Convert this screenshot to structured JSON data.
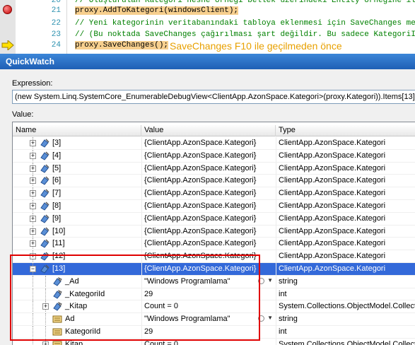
{
  "editor": {
    "lines": [
      {
        "num": "20",
        "text": "// Oluşturulan Kategori nesne örneği bellek üzerindeki Entity örneğine ilave edilir",
        "kind": "comment"
      },
      {
        "num": "21",
        "text": "proxy.AddToKategori(windowsClient);",
        "kind": "highlight"
      },
      {
        "num": "22",
        "text": "// Yeni kategorinin veritabanındaki tabloya eklenmesi için SaveChanges metodu çağırılır.",
        "kind": "comment"
      },
      {
        "num": "23",
        "text": "// (Bu noktada SaveChanges çağırılması şart değildir. Bu sadece KategoriId' nin tablodan e",
        "kind": "comment"
      },
      {
        "num": "24",
        "text": "proxy.SaveChanges();",
        "kind": "highlight"
      }
    ],
    "annotation": "SaveChanges F10 ile geçilmeden önce",
    "annotation_color": "#e8a000"
  },
  "quickwatch": {
    "title": "QuickWatch",
    "expression_label": "Expression:",
    "expression_value": "(new System.Linq.SystemCore_EnumerableDebugView<ClientApp.AzonSpace.Kategori>(proxy.Kategori)).Items[13]",
    "value_label": "Value:",
    "columns": {
      "name": "Name",
      "value": "Value",
      "type": "Type"
    },
    "rows": [
      {
        "name": "[3]",
        "value": "{ClientApp.AzonSpace.Kategori}",
        "type": "ClientApp.AzonSpace.Kategori",
        "indent": 1,
        "toggle": "+",
        "icon": "object-icon",
        "selected": false
      },
      {
        "name": "[4]",
        "value": "{ClientApp.AzonSpace.Kategori}",
        "type": "ClientApp.AzonSpace.Kategori",
        "indent": 1,
        "toggle": "+",
        "icon": "object-icon",
        "selected": false
      },
      {
        "name": "[5]",
        "value": "{ClientApp.AzonSpace.Kategori}",
        "type": "ClientApp.AzonSpace.Kategori",
        "indent": 1,
        "toggle": "+",
        "icon": "object-icon",
        "selected": false
      },
      {
        "name": "[6]",
        "value": "{ClientApp.AzonSpace.Kategori}",
        "type": "ClientApp.AzonSpace.Kategori",
        "indent": 1,
        "toggle": "+",
        "icon": "object-icon",
        "selected": false
      },
      {
        "name": "[7]",
        "value": "{ClientApp.AzonSpace.Kategori}",
        "type": "ClientApp.AzonSpace.Kategori",
        "indent": 1,
        "toggle": "+",
        "icon": "object-icon",
        "selected": false
      },
      {
        "name": "[8]",
        "value": "{ClientApp.AzonSpace.Kategori}",
        "type": "ClientApp.AzonSpace.Kategori",
        "indent": 1,
        "toggle": "+",
        "icon": "object-icon",
        "selected": false
      },
      {
        "name": "[9]",
        "value": "{ClientApp.AzonSpace.Kategori}",
        "type": "ClientApp.AzonSpace.Kategori",
        "indent": 1,
        "toggle": "+",
        "icon": "object-icon",
        "selected": false
      },
      {
        "name": "[10]",
        "value": "{ClientApp.AzonSpace.Kategori}",
        "type": "ClientApp.AzonSpace.Kategori",
        "indent": 1,
        "toggle": "+",
        "icon": "object-icon",
        "selected": false
      },
      {
        "name": "[11]",
        "value": "{ClientApp.AzonSpace.Kategori}",
        "type": "ClientApp.AzonSpace.Kategori",
        "indent": 1,
        "toggle": "+",
        "icon": "object-icon",
        "selected": false
      },
      {
        "name": "[12]",
        "value": "{ClientApp.AzonSpace.Kategori}",
        "type": "ClientApp.AzonSpace.Kategori",
        "indent": 1,
        "toggle": "+",
        "icon": "object-icon",
        "selected": false
      },
      {
        "name": "[13]",
        "value": "{ClientApp.AzonSpace.Kategori}",
        "type": "ClientApp.AzonSpace.Kategori",
        "indent": 1,
        "toggle": "-",
        "icon": "object-icon",
        "selected": true
      },
      {
        "name": "_Ad",
        "value": "\"Windows Programlama\"",
        "type": "string",
        "indent": 2,
        "toggle": "",
        "icon": "field-icon",
        "selected": false,
        "inspect": true
      },
      {
        "name": "_KategoriId",
        "value": "29",
        "type": "int",
        "indent": 2,
        "toggle": "",
        "icon": "field-icon",
        "selected": false
      },
      {
        "name": "_Kitap",
        "value": "Count = 0",
        "type": "System.Collections.ObjectModel.Collection",
        "indent": 2,
        "toggle": "+",
        "icon": "field-icon",
        "selected": false
      },
      {
        "name": "Ad",
        "value": "\"Windows Programlama\"",
        "type": "string",
        "indent": 2,
        "toggle": "",
        "icon": "property-icon",
        "selected": false,
        "inspect": true
      },
      {
        "name": "KategoriId",
        "value": "29",
        "type": "int",
        "indent": 2,
        "toggle": "",
        "icon": "property-icon",
        "selected": false
      },
      {
        "name": "Kitap",
        "value": "Count = 0",
        "type": "System.Collections.ObjectModel.Collection",
        "indent": 2,
        "toggle": "+",
        "icon": "property-icon",
        "selected": false
      }
    ]
  },
  "colors": {
    "comment": "#008000",
    "highlight_bg": "#f7cf8e",
    "selection": "#3369d9",
    "annotation_box": "#e00000"
  }
}
